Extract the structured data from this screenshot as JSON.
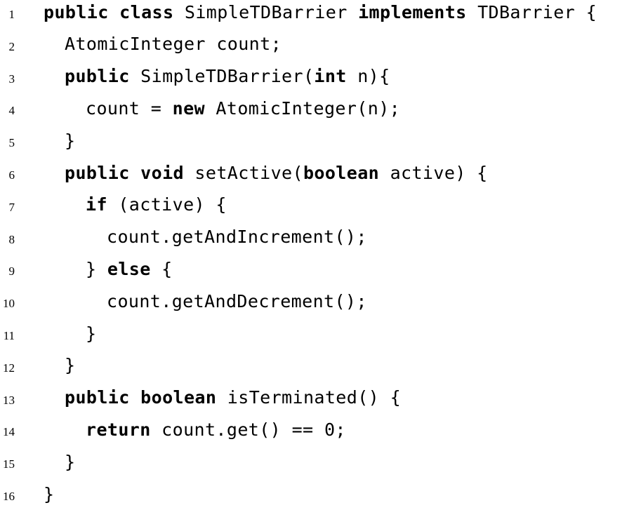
{
  "listing": {
    "lines": [
      {
        "number": "1",
        "indent": 0,
        "tokens": [
          {
            "t": "public",
            "kw": true
          },
          {
            "t": " "
          },
          {
            "t": "class",
            "kw": true
          },
          {
            "t": " SimpleTDBarrier "
          },
          {
            "t": "implements",
            "kw": true
          },
          {
            "t": " TDBarrier {"
          }
        ]
      },
      {
        "number": "2",
        "indent": 1,
        "tokens": [
          {
            "t": "AtomicInteger count;"
          }
        ]
      },
      {
        "number": "3",
        "indent": 1,
        "tokens": [
          {
            "t": "public",
            "kw": true
          },
          {
            "t": " SimpleTDBarrier("
          },
          {
            "t": "int",
            "kw": true
          },
          {
            "t": " n){"
          }
        ]
      },
      {
        "number": "4",
        "indent": 2,
        "tokens": [
          {
            "t": "count = "
          },
          {
            "t": "new",
            "kw": true
          },
          {
            "t": " AtomicInteger(n);"
          }
        ]
      },
      {
        "number": "5",
        "indent": 1,
        "tokens": [
          {
            "t": "}"
          }
        ]
      },
      {
        "number": "6",
        "indent": 1,
        "tokens": [
          {
            "t": "public",
            "kw": true
          },
          {
            "t": " "
          },
          {
            "t": "void",
            "kw": true
          },
          {
            "t": " setActive("
          },
          {
            "t": "boolean",
            "kw": true
          },
          {
            "t": " active) {"
          }
        ]
      },
      {
        "number": "7",
        "indent": 2,
        "tokens": [
          {
            "t": "if",
            "kw": true
          },
          {
            "t": " (active) {"
          }
        ]
      },
      {
        "number": "8",
        "indent": 3,
        "tokens": [
          {
            "t": "count.getAndIncrement();"
          }
        ]
      },
      {
        "number": "9",
        "indent": 2,
        "tokens": [
          {
            "t": "} "
          },
          {
            "t": "else",
            "kw": true
          },
          {
            "t": " {"
          }
        ]
      },
      {
        "number": "10",
        "indent": 3,
        "tokens": [
          {
            "t": "count.getAndDecrement();"
          }
        ]
      },
      {
        "number": "11",
        "indent": 2,
        "tokens": [
          {
            "t": "}"
          }
        ]
      },
      {
        "number": "12",
        "indent": 1,
        "tokens": [
          {
            "t": "}"
          }
        ]
      },
      {
        "number": "13",
        "indent": 1,
        "tokens": [
          {
            "t": "public",
            "kw": true
          },
          {
            "t": " "
          },
          {
            "t": "boolean",
            "kw": true
          },
          {
            "t": " isTerminated() {"
          }
        ]
      },
      {
        "number": "14",
        "indent": 2,
        "tokens": [
          {
            "t": "return",
            "kw": true
          },
          {
            "t": " count.get() == 0;"
          }
        ]
      },
      {
        "number": "15",
        "indent": 1,
        "tokens": [
          {
            "t": "}"
          }
        ]
      },
      {
        "number": "16",
        "indent": 0,
        "tokens": [
          {
            "t": "}"
          }
        ]
      }
    ]
  }
}
